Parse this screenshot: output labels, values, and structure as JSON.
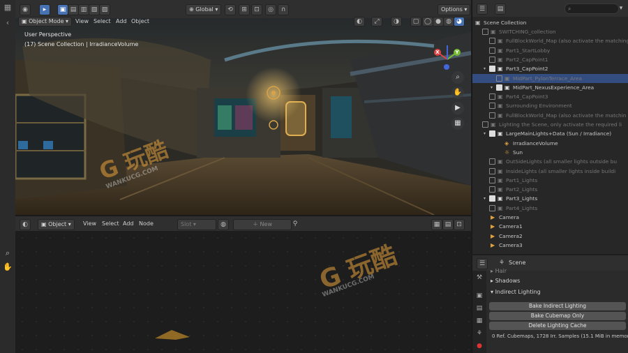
{
  "viewport_header": {
    "mode": "Object Mode",
    "menus": [
      "View",
      "Select",
      "Add",
      "Object"
    ],
    "transform_orientation": "Global",
    "options_label": "Options"
  },
  "viewport": {
    "perspective": "User Perspective",
    "collection_info": "(17) Scene Collection | IrradianceVolume",
    "gizmo": {
      "x": "X",
      "y": "Y",
      "z": "Z"
    }
  },
  "node_header": {
    "mode": "Object",
    "menus": [
      "View",
      "Select",
      "Add",
      "Node"
    ],
    "slot_placeholder": "Slot",
    "new_label": "New"
  },
  "outliner": {
    "search_placeholder": "",
    "root": "Scene Collection",
    "rows": [
      {
        "label": "SWITCHING_collection",
        "indent": 1,
        "icon": "collection",
        "checked": false,
        "dim": true
      },
      {
        "label": "FullBlockWorld_Map (also activate the matching",
        "indent": 2,
        "icon": "collection",
        "checked": false,
        "dim": true
      },
      {
        "label": "Part1_StartLobby",
        "indent": 2,
        "icon": "collection",
        "checked": false,
        "dim": true
      },
      {
        "label": "Part2_CapPoint1",
        "indent": 2,
        "icon": "collection",
        "checked": false,
        "dim": true
      },
      {
        "label": "Part3_CapPoint2",
        "indent": 2,
        "icon": "collection",
        "checked": true,
        "dim": false
      },
      {
        "label": "MidPart_PylonTerrace_Area",
        "indent": 3,
        "icon": "collection",
        "checked": false,
        "dim": true,
        "selected": true
      },
      {
        "label": "MidPart_NexusExperience_Area",
        "indent": 3,
        "icon": "collection",
        "checked": true,
        "dim": false
      },
      {
        "label": "Part4_CapPoint3",
        "indent": 2,
        "icon": "collection",
        "checked": false,
        "dim": true
      },
      {
        "label": "Surrounding Environment",
        "indent": 2,
        "icon": "collection",
        "checked": false,
        "dim": true
      },
      {
        "label": "FullBlockWorld_Map (also activate the matchin",
        "indent": 2,
        "icon": "collection",
        "checked": false,
        "dim": true
      },
      {
        "label": "Lighting the Scene, only activate the required li",
        "indent": 1,
        "icon": "collection",
        "checked": false,
        "dim": true
      },
      {
        "label": "LargeMainLights+Data (Sun / Irradiance)",
        "indent": 2,
        "icon": "collection",
        "checked": true,
        "dim": false
      },
      {
        "label": "IrradianceVolume",
        "indent": 3,
        "icon": "probe",
        "checked": null,
        "dim": false
      },
      {
        "label": "Sun",
        "indent": 3,
        "icon": "light",
        "checked": null,
        "dim": false
      },
      {
        "label": "OutSideLights (all smaller lights outside bu",
        "indent": 2,
        "icon": "collection",
        "checked": false,
        "dim": true
      },
      {
        "label": "InsideLights (all smaller lights inside buildi",
        "indent": 2,
        "icon": "collection",
        "checked": false,
        "dim": true
      },
      {
        "label": "Part1_Lights",
        "indent": 2,
        "icon": "collection",
        "checked": false,
        "dim": true
      },
      {
        "label": "Part2_Lights",
        "indent": 2,
        "icon": "collection",
        "checked": false,
        "dim": true
      },
      {
        "label": "Part3_Lights",
        "indent": 2,
        "icon": "collection",
        "checked": true,
        "dim": false
      },
      {
        "label": "Part4_Lights",
        "indent": 2,
        "icon": "collection",
        "checked": false,
        "dim": true
      },
      {
        "label": "Camera",
        "indent": 1,
        "icon": "camera",
        "checked": null,
        "dim": false
      },
      {
        "label": "Camera1",
        "indent": 1,
        "icon": "camera",
        "checked": null,
        "dim": false
      },
      {
        "label": "Camera2",
        "indent": 1,
        "icon": "camera",
        "checked": null,
        "dim": false
      },
      {
        "label": "Camera3",
        "indent": 1,
        "icon": "camera",
        "checked": null,
        "dim": false
      }
    ]
  },
  "properties": {
    "context": "Scene",
    "sections": {
      "hair": "Hair",
      "shadows": "Shadows",
      "indirect": "Indirect Lighting"
    },
    "buttons": {
      "bake_indirect": "Bake Indirect Lighting",
      "bake_cubemap": "Bake Cubemap Only",
      "delete_cache": "Delete Lighting Cache"
    },
    "info": "0 Ref. Cubemaps, 1728 Irr. Samples (15.1 MiB in memory)"
  },
  "watermark": {
    "brand": "玩酷",
    "url": "WANKUCG.COM"
  },
  "colors": {
    "accent": "#4772b3",
    "selection": "#334d80"
  }
}
